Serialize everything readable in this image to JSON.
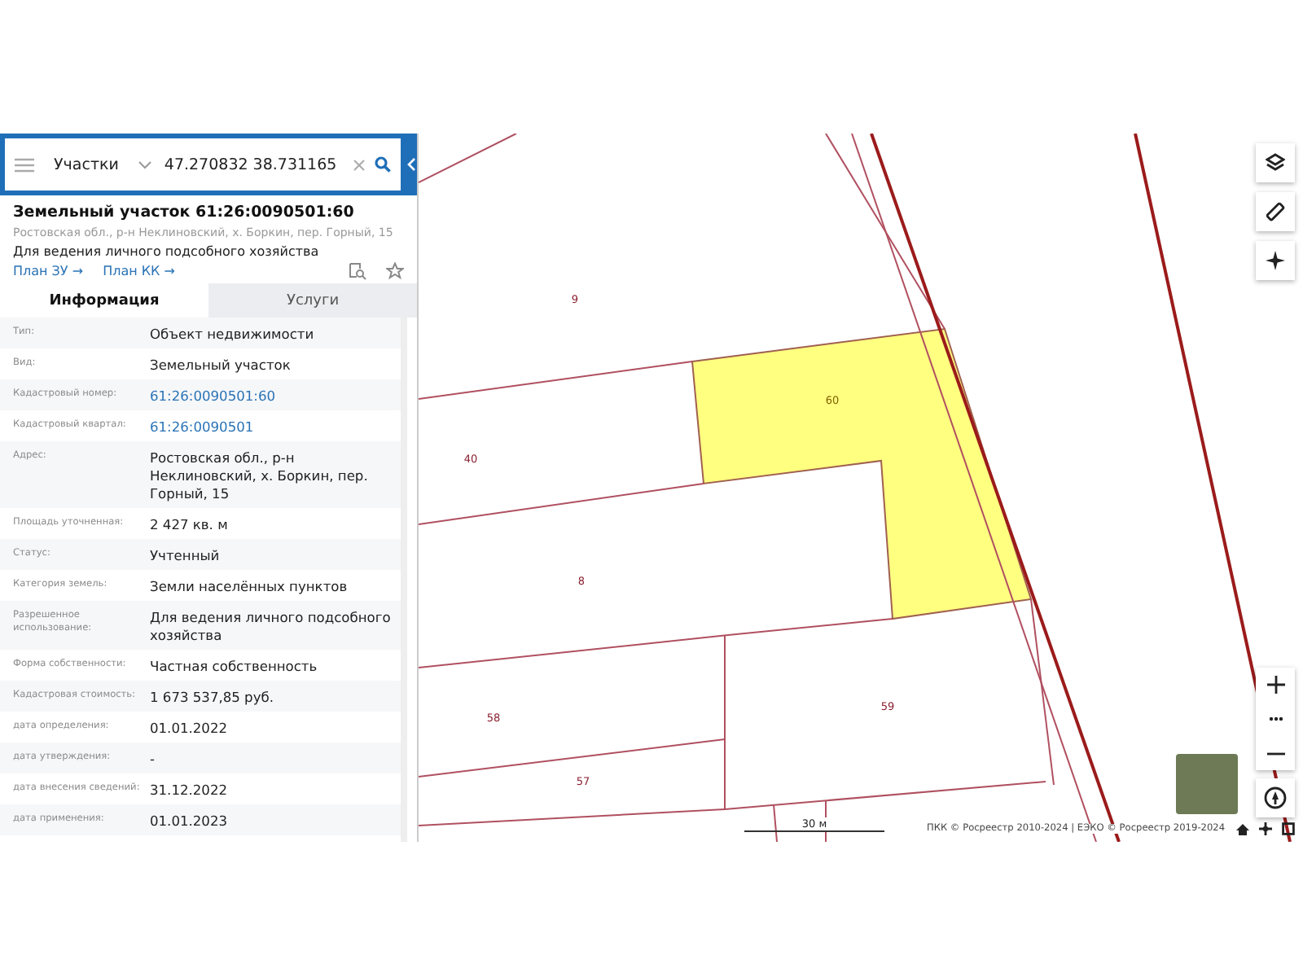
{
  "search_bar": {
    "layer": "Участки",
    "value": "47.270832 38.731165"
  },
  "object_card": {
    "title": "Земельный участок 61:26:0090501:60",
    "address": "Ростовская обл., р-н Неклиновский, х. Боркин, пер. Горный, 15",
    "purpose": "Для ведения личного подсобного хозяйства",
    "links": [
      "План ЗУ →",
      "План КК →"
    ]
  },
  "tabs": [
    {
      "label": "Информация",
      "selected": true
    },
    {
      "label": "Услуги",
      "selected": false
    }
  ],
  "properties": [
    {
      "label": "Тип:",
      "value": "Объект недвижимости",
      "kind": "text"
    },
    {
      "label": "Вид:",
      "value": "Земельный участок",
      "kind": "text"
    },
    {
      "label": "Кадастровый номер:",
      "value": "61:26:0090501:60",
      "kind": "link"
    },
    {
      "label": "Кадастровый квартал:",
      "value": "61:26:0090501",
      "kind": "link"
    },
    {
      "label": "Адрес:",
      "value": "Ростовская обл., р-н Неклиновский, х. Боркин, пер. Горный, 15",
      "kind": "text"
    },
    {
      "label": "Площадь уточненная:",
      "value": "2 427 кв. м",
      "kind": "text"
    },
    {
      "label": "Статус:",
      "value": "Учтенный",
      "kind": "text"
    },
    {
      "label": "Категория земель:",
      "value": "Земли населённых пунктов",
      "kind": "text"
    },
    {
      "label": "Разрешенное использование:",
      "value": "Для ведения личного подсобного хозяйства",
      "kind": "text"
    },
    {
      "label": "Форма собственности:",
      "value": "Частная собственность",
      "kind": "text"
    },
    {
      "label": "Кадастровая стоимость:",
      "value": "1 673 537,85 руб.",
      "kind": "text"
    },
    {
      "label": "дата определения:",
      "value": "01.01.2022",
      "kind": "text"
    },
    {
      "label": "дата утверждения:",
      "value": "-",
      "kind": "text"
    },
    {
      "label": "дата внесения сведений:",
      "value": "31.12.2022",
      "kind": "text"
    },
    {
      "label": "дата применения:",
      "value": "01.01.2023",
      "kind": "text"
    }
  ],
  "map": {
    "parcels": [
      {
        "label": "9",
        "selected": false
      },
      {
        "label": "60",
        "selected": true
      },
      {
        "label": "40",
        "selected": false
      },
      {
        "label": "8",
        "selected": false
      },
      {
        "label": "58",
        "selected": false
      },
      {
        "label": "59",
        "selected": false
      },
      {
        "label": "57",
        "selected": false
      }
    ],
    "scale_bar": "30 м",
    "attribution": "ПКК © Росреестр 2010-2024 | ЕЭКО © Росреестр 2019-2024"
  }
}
